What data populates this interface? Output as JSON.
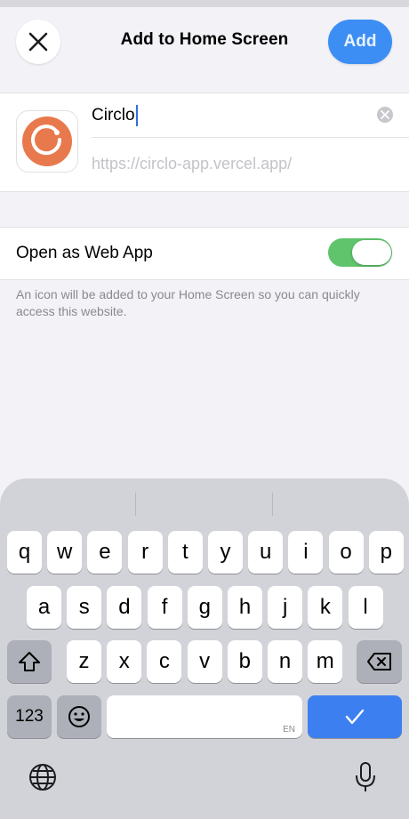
{
  "header": {
    "title": "Add to Home Screen",
    "add_label": "Add",
    "close_icon": "close-icon"
  },
  "app": {
    "name_value": "Circlo",
    "url_placeholder": "https://circlo-app.vercel.app/",
    "icon": "circlo-app-icon",
    "icon_color": "#e8794d"
  },
  "webapp": {
    "label": "Open as Web App",
    "enabled": true,
    "toggle_color": "#5fc46b"
  },
  "footnote": "An icon will be added to your Home Screen so you can quickly access this website.",
  "keyboard": {
    "row1": [
      "q",
      "w",
      "e",
      "r",
      "t",
      "y",
      "u",
      "i",
      "o",
      "p"
    ],
    "row2": [
      "a",
      "s",
      "d",
      "f",
      "g",
      "h",
      "j",
      "k",
      "l"
    ],
    "row3": [
      "z",
      "x",
      "c",
      "v",
      "b",
      "n",
      "m"
    ],
    "numbers_label": "123",
    "space_lang": "EN",
    "return_color": "#3c7ff0"
  }
}
